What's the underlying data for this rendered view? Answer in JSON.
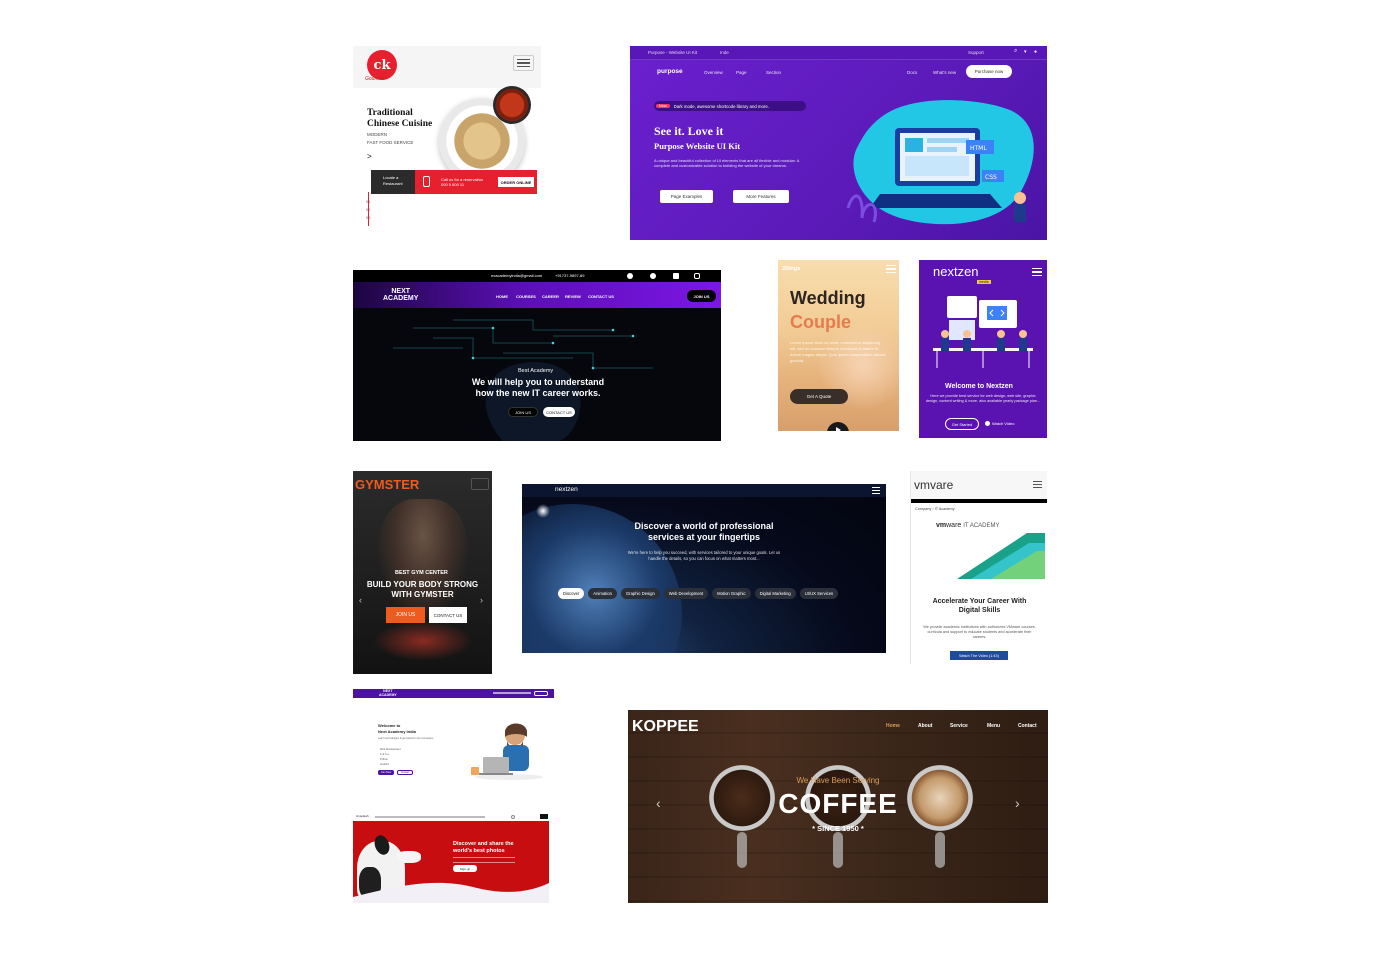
{
  "restaurant": {
    "logo_letters": "ck",
    "logo_script": "Gourmet",
    "title_line1": "Traditional",
    "title_line2": "Chinese Cuisine",
    "sub1": "MODERN",
    "sub2": "FAST FOOD SERVICE",
    "arrow": ">",
    "locate_line1": "Locate a",
    "locate_line2": "Restaurant",
    "call_line1": "Call us for a reservation",
    "call_line2": "000 5 600 11",
    "order_label": "ORDER ONLINE",
    "slide_nums": [
      "01",
      "02",
      "03"
    ]
  },
  "purpose": {
    "topbar_title": "Purpose - Website UI Kit",
    "topbar_link": "Inde",
    "topbar_support": "Support",
    "brand": "purpose",
    "nav": [
      "Overview",
      "Page",
      "Section"
    ],
    "nav_right": [
      "Docs",
      "What's new"
    ],
    "purchase_label": "Purchase now",
    "badge_new": "New",
    "announce": "Dark mode, awesome shortcode library and more.",
    "headline": "See it. Love it",
    "subheadline": "Purpose Website UI Kit",
    "description": "A unique and beautiful collection of UI elements that are all flexible and modular. A complete and customizable solution to building the website of your dreams.",
    "btn_examples": "Page Examples",
    "btn_features": "More Features",
    "illus_html": "HTML",
    "illus_css": "CSS"
  },
  "academy": {
    "email": "exacademyindia@gmail.com",
    "phone": "+91737-9897-89",
    "logo_line1": "NEXT",
    "logo_line2": "ACADEMY",
    "nav": [
      "HOME",
      "COURSES",
      "CAREER",
      "REVIEW",
      "CONTACT US"
    ],
    "join_label": "JOIN US",
    "eyebrow": "Best Academy",
    "headline_line1": "We will help you to understand",
    "headline_line2": "how the new IT career works.",
    "btn_join": "JOIN US",
    "btn_contact": "CONTACT US"
  },
  "wedding": {
    "brand": "2Rings",
    "title_line1": "Wedding",
    "title_line2": "Couple",
    "body": "Lorem ipsum dolor sit amet, consectetur adipiscing elit, sed do eiusmod tempor incididunt ut labore et dolore magna aliqua. Quis ipsum suspendisse ultrices gravida.",
    "btn_quote": "Get A Quote"
  },
  "nextzen_mobile": {
    "brand": "nextzen",
    "brand_sub": "media",
    "title": "Welcome to Nextzen",
    "body": "Here we provide best service for web design, web site, graphic design, content writing & more. also available yearly package plan...",
    "btn_started": "Get Started",
    "btn_video": "Watch Video"
  },
  "gymster": {
    "brand": "GYMSTER",
    "eyebrow": "BEST GYM CENTER",
    "headline_line1": "BUILD YOUR BODY STRONG",
    "headline_line2": "WITH GYMSTER",
    "btn_join": "JOIN US",
    "btn_contact": "CONTACT US"
  },
  "nextzen_desktop": {
    "brand": "nextzen",
    "headline_line1": "Discover a world of professional",
    "headline_line2": "services at your fingertips",
    "body_line1": "We're here to help you succeed, with services tailored to your unique goals. Let us",
    "body_line2": "handle the details, so you can focus on what matters most...",
    "chips": [
      "Discover",
      "Animation",
      "Graphic Design",
      "Web Development",
      "Motion Graphic",
      "Digital Marketing",
      "UI/UX Services"
    ]
  },
  "vmware": {
    "brand": "vmvare",
    "breadcrumb_home": "Company",
    "breadcrumb_current": "IT Academy",
    "logo_vm": "vm",
    "logo_ware": "ware",
    "logo_academy": "IT ACADEMY",
    "title_line1": "Accelerate Your Career With",
    "title_line2": "Digital Skills",
    "body": "We provide academic institutions with authorized VMware courses, curricula and support to educate students and accelerate their careers.",
    "btn_video": "Watch The Video (1:43)"
  },
  "academy_desktop": {
    "logo_line1": "NEXT",
    "logo_line2": "ACADEMY",
    "welcome_line1": "Welcome to",
    "welcome_line2": "Next Academy India",
    "body": "Learn technologies & get placed in top companies",
    "list": [
      "Web Development",
      "C & C++",
      "Python",
      "Android"
    ],
    "btn1": "Join Now",
    "btn2": "Contact"
  },
  "photos": {
    "brand": "Unsplash",
    "headline_line1": "Discover and share the",
    "headline_line2": "world's best photos",
    "btn_signup": "Sign up"
  },
  "koppee": {
    "brand": "KOPPEE",
    "nav": [
      "Home",
      "About",
      "Service",
      "Menu",
      "Contact"
    ],
    "eyebrow": "We Have Been Serving",
    "headline": "COFFEE",
    "since": "* SINCE 1950 *",
    "prev": "‹",
    "next": "›"
  },
  "colors": {
    "purple": "#6a1fd0",
    "academy_purple": "#6d12c9",
    "nextzen_purple": "#5a12b0",
    "gym_orange": "#ee5b1f",
    "koppee_gold": "#da9f5b",
    "restaurant_red": "#e7202f"
  }
}
